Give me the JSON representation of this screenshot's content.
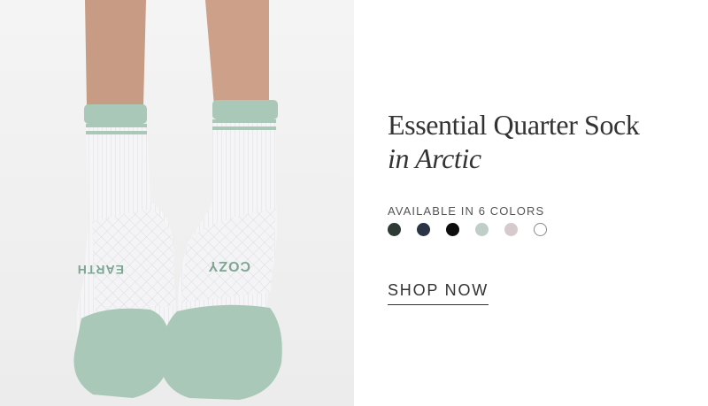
{
  "product": {
    "name": "Essential Quarter Sock",
    "variant": "in Arctic"
  },
  "colors": {
    "label": "AVAILABLE IN 6 COLORS",
    "swatches": [
      {
        "name": "dark-green",
        "hex": "#2e3b35"
      },
      {
        "name": "navy",
        "hex": "#2b3346"
      },
      {
        "name": "black",
        "hex": "#0d0d0d"
      },
      {
        "name": "arctic",
        "hex": "#bfcfc7"
      },
      {
        "name": "mauve",
        "hex": "#d6cacd"
      },
      {
        "name": "white",
        "hex": "#ffffff"
      }
    ]
  },
  "cta": {
    "label": "SHOP NOW"
  },
  "image": {
    "left_sock_text": "EARTH",
    "right_sock_text": "COZY",
    "accent_color": "#a9c8b7",
    "sock_color": "#f4f4f6"
  }
}
